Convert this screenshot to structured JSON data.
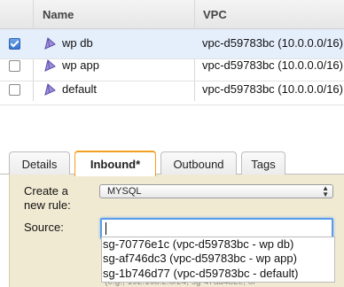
{
  "table": {
    "columns": [
      "Name",
      "VPC"
    ],
    "rows": [
      {
        "name": "wp db",
        "vpc": "vpc-d59783bc (10.0.0.0/16)",
        "checked": true
      },
      {
        "name": "wp app",
        "vpc": "vpc-d59783bc (10.0.0.0/16)",
        "checked": false
      },
      {
        "name": "default",
        "vpc": "vpc-d59783bc (10.0.0.0/16)",
        "checked": false
      }
    ]
  },
  "tabs": [
    {
      "label": "Details"
    },
    {
      "label": "Inbound*",
      "active": true
    },
    {
      "label": "Outbound"
    },
    {
      "label": "Tags"
    }
  ],
  "form": {
    "create_rule_label_1": "Create a",
    "create_rule_label_2": "new rule:",
    "rule_type_value": "MYSQL",
    "source_label": "Source:",
    "source_value": "",
    "suggestions": [
      "sg-70776e1c (vpc-d59783bc - wp db)",
      "sg-af746dc3 (vpc-d59783bc - wp app)",
      "sg-1b746d77 (vpc-d59783bc - default)"
    ],
    "hint": "(e.g., 192.168.2.0/24, sg-47ad482e, or"
  },
  "colors": {
    "selected_row": "#e5eefb",
    "panel_bg": "#f1ead3",
    "active_tab_border": "#f0a020",
    "focus_border": "#5b9ce8"
  }
}
